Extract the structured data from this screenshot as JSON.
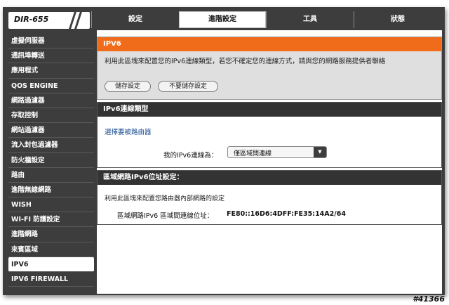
{
  "logo": {
    "text": "DIR-655"
  },
  "tabs": [
    {
      "label": "設定"
    },
    {
      "label": "進階設定"
    },
    {
      "label": "工具"
    },
    {
      "label": "狀態"
    }
  ],
  "active_tab": "進階設定",
  "sidebar": {
    "items": [
      {
        "label": "虛擬伺服器"
      },
      {
        "label": "通訊埠轉送"
      },
      {
        "label": "應用程式"
      },
      {
        "label": "QOS ENGINE"
      },
      {
        "label": "網路過濾器"
      },
      {
        "label": "存取控制"
      },
      {
        "label": "網站過濾器"
      },
      {
        "label": "流入封包過濾器"
      },
      {
        "label": "防火牆設定"
      },
      {
        "label": "路由"
      },
      {
        "label": "進階無線網路"
      },
      {
        "label": "WISH"
      },
      {
        "label": "WI-FI 防護設定"
      },
      {
        "label": "進階網路"
      },
      {
        "label": "來賓區域"
      },
      {
        "label": "IPV6"
      },
      {
        "label": "IPV6 FIREWALL"
      }
    ],
    "active": "IPV6"
  },
  "ipv6_panel": {
    "title": "IPV6",
    "description": "利用此區塊來配置您的IPv6連線類型，若您不確定您的連線方式，請與您的網路服務提供者聯絡",
    "save_label": "儲存設定",
    "nosave_label": "不要儲存設定"
  },
  "conn_panel": {
    "title": "IPv6連線類型",
    "link_text": "選擇要被路由器",
    "field_label": "我的IPv6連線為：",
    "selected": "僅區域間連線"
  },
  "lan_panel": {
    "title": "區域網路IPv6位址設定：",
    "description": "利用此區塊來配置您路由器內部網路的設定",
    "address_label": "區域網路IPv6 區域間連線位址：",
    "address_value": "FE80::16D6:4DFF:FE35:14A2/64"
  },
  "watermark": "#41366",
  "colors": {
    "accent": "#f06c1a",
    "chrome": "#3d3d3d",
    "link": "#1a4d8f"
  }
}
